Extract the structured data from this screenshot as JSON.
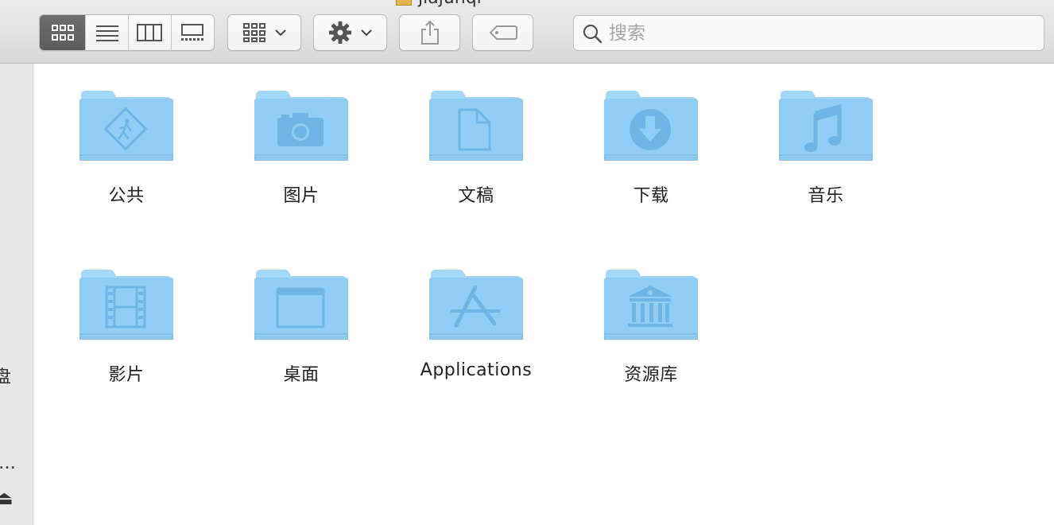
{
  "window": {
    "title": "jiajunqi"
  },
  "toolbar": {
    "view_modes": [
      {
        "name": "icon-view",
        "active": true
      },
      {
        "name": "list-view",
        "active": false
      },
      {
        "name": "column-view",
        "active": false
      },
      {
        "name": "gallery-view",
        "active": false
      }
    ],
    "group_button": "group-by",
    "action_button": "action",
    "share_button": "share",
    "tag_button": "edit-tags",
    "search": {
      "placeholder": "搜索",
      "value": ""
    }
  },
  "sidebar": {
    "fragments": [
      "盘",
      "…",
      "⏏"
    ]
  },
  "folders": [
    {
      "label": "公共",
      "icon": "public-walking-person-icon"
    },
    {
      "label": "图片",
      "icon": "camera-icon"
    },
    {
      "label": "文稿",
      "icon": "document-icon"
    },
    {
      "label": "下载",
      "icon": "download-arrow-icon"
    },
    {
      "label": "音乐",
      "icon": "music-note-icon"
    },
    {
      "label": "影片",
      "icon": "film-strip-icon"
    },
    {
      "label": "桌面",
      "icon": "desktop-window-icon"
    },
    {
      "label": "Applications",
      "icon": "app-store-icon"
    },
    {
      "label": "资源库",
      "icon": "library-building-icon"
    }
  ],
  "colors": {
    "folder_body": "#8fcdf5",
    "folder_tab": "#9fd6f8",
    "folder_symbol": "#6fb6e6",
    "active_segment": "#666666"
  }
}
